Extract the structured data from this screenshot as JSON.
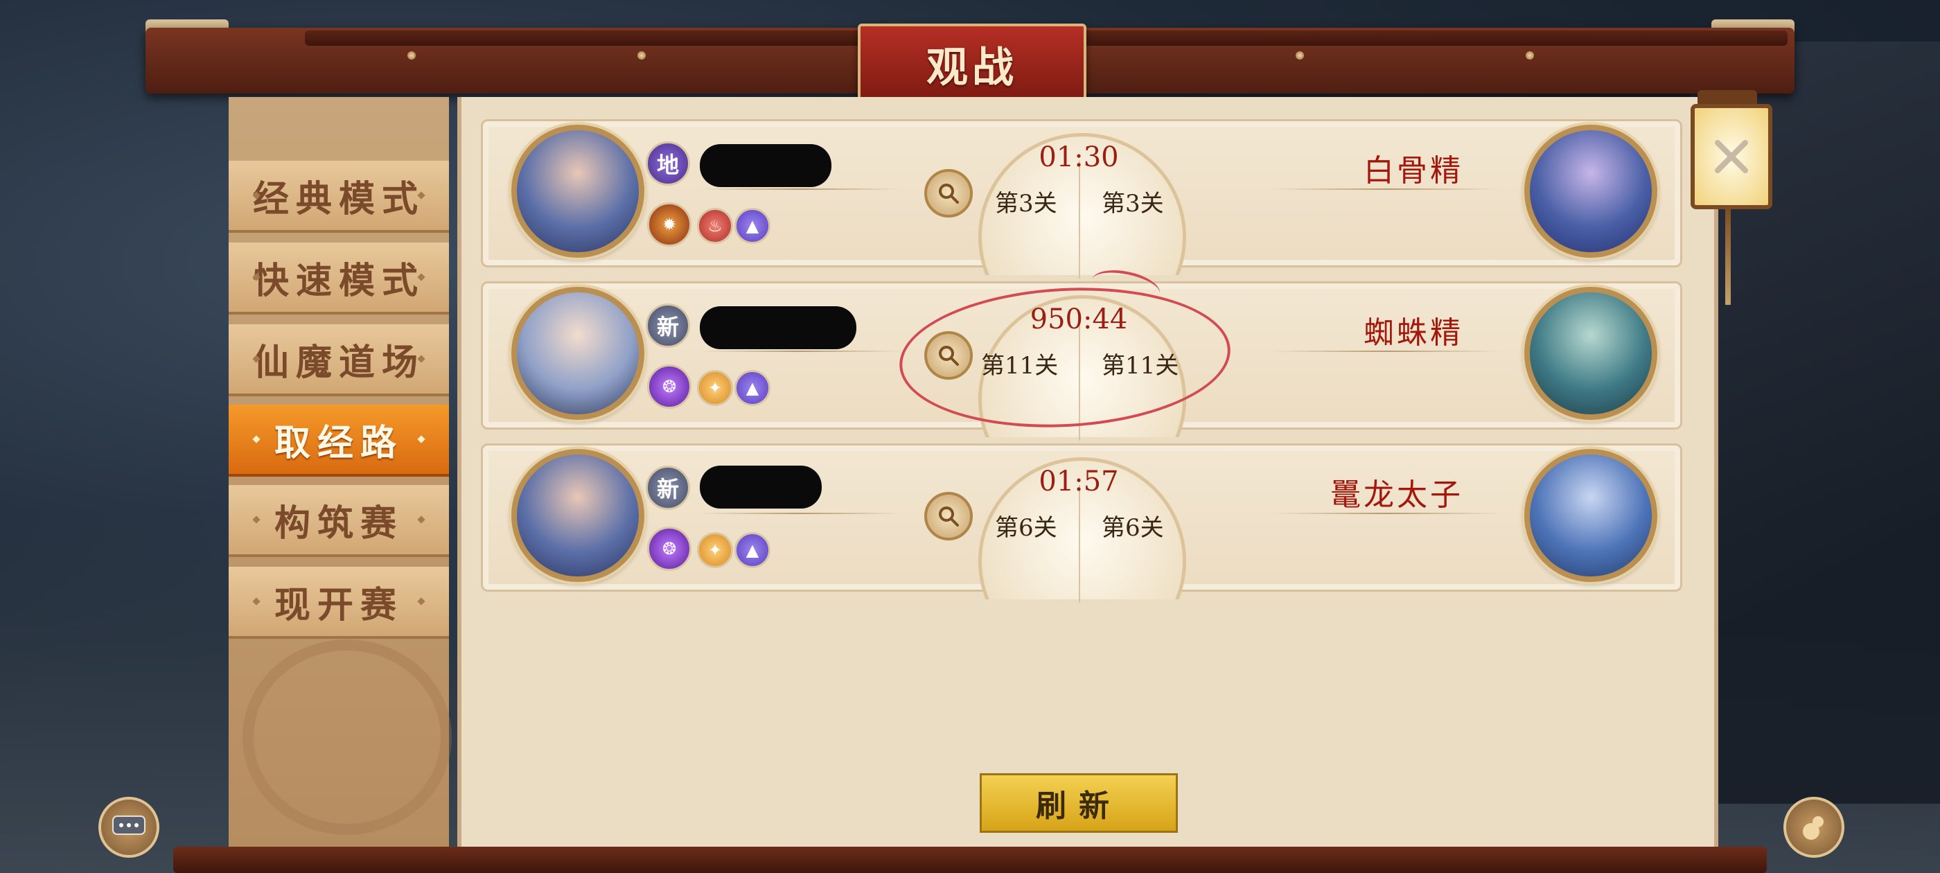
{
  "window": {
    "title": "观战"
  },
  "sidebar": {
    "tabs": [
      {
        "label": "经典模式",
        "active": false
      },
      {
        "label": "快速模式",
        "active": false
      },
      {
        "label": "仙魔道场",
        "active": false
      },
      {
        "label": "取经路",
        "active": true
      },
      {
        "label": "构筑赛",
        "active": false
      },
      {
        "label": "现开赛",
        "active": false
      }
    ]
  },
  "matches": [
    {
      "player_badge": "地",
      "timer": "01:30",
      "left_stage": "第3关",
      "right_stage": "第3关",
      "opponent": "白骨精",
      "skills": [
        "fire-dragon-icon",
        "flame-icon",
        "peak-icon"
      ]
    },
    {
      "player_badge": "新",
      "timer": "950:44",
      "left_stage": "第11关",
      "right_stage": "第11关",
      "opponent": "蜘蛛精",
      "skills": [
        "vortex-icon",
        "star-icon",
        "peak-icon"
      ]
    },
    {
      "player_badge": "新",
      "timer": "01:57",
      "left_stage": "第6关",
      "right_stage": "第6关",
      "opponent": "鼍龙太子",
      "skills": [
        "vortex-icon",
        "star-icon",
        "peak-icon"
      ]
    }
  ],
  "actions": {
    "refresh_label": "刷新",
    "close_icon": "close-icon"
  },
  "colors": {
    "accent_tab": "#e07a18",
    "title_plaque": "#9b2419",
    "opponent_name": "#a3170d",
    "refresh": "#e9bd34",
    "annotation": "#d24b52"
  }
}
